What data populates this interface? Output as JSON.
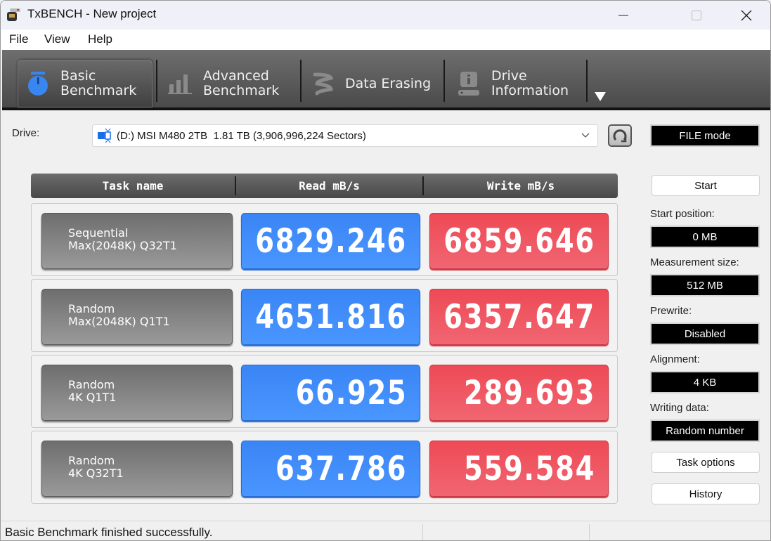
{
  "window": {
    "title": "TxBENCH - New project",
    "minimize": "minimize",
    "maximize": "maximize",
    "close": "close"
  },
  "menu": [
    "File",
    "View",
    "Help"
  ],
  "tabs": [
    {
      "label": "Basic\nBenchmark",
      "line1": "Basic",
      "line2": "Benchmark",
      "icon": "stopwatch-icon",
      "active": true
    },
    {
      "label": "Advanced\nBenchmark",
      "line1": "Advanced",
      "line2": "Benchmark",
      "icon": "bar-chart-icon",
      "active": false
    },
    {
      "label": "Data Erasing",
      "line1": "Data Erasing",
      "line2": "",
      "icon": "eraser-icon",
      "active": false
    },
    {
      "label": "Drive\nInformation",
      "line1": "Drive",
      "line2": "Information",
      "icon": "drive-info-icon",
      "active": false
    }
  ],
  "drive": {
    "label": "Drive:",
    "selected": "(D:) MSI M480 2TB  1.81 TB (3,906,996,224 Sectors)"
  },
  "mode": "FILE mode",
  "table": {
    "headers": [
      "Task name",
      "Read mB/s",
      "Write mB/s"
    ],
    "rows": [
      {
        "task": "Sequential\nMax(2048K) Q32T1",
        "read": "6829.246",
        "write": "6859.646"
      },
      {
        "task": "Random\nMax(2048K) Q1T1",
        "read": "4651.816",
        "write": "6357.647"
      },
      {
        "task": "Random\n4K Q1T1",
        "read": "66.925",
        "write": "289.693"
      },
      {
        "task": "Random\n4K Q32T1",
        "read": "637.786",
        "write": "559.584"
      }
    ]
  },
  "side": {
    "start": "Start",
    "start_position_label": "Start position:",
    "start_position": "0 MB",
    "measurement_size_label": "Measurement size:",
    "measurement_size": "512 MB",
    "prewrite_label": "Prewrite:",
    "prewrite": "Disabled",
    "alignment_label": "Alignment:",
    "alignment": "4 KB",
    "writing_data_label": "Writing data:",
    "writing_data": "Random number",
    "task_options": "Task options",
    "history": "History"
  },
  "status": "Basic Benchmark finished successfully.",
  "colors": {
    "read": "#3f8cf8",
    "write": "#ef5560",
    "toolbar": "#555555",
    "active_icon": "#3a86f0"
  }
}
